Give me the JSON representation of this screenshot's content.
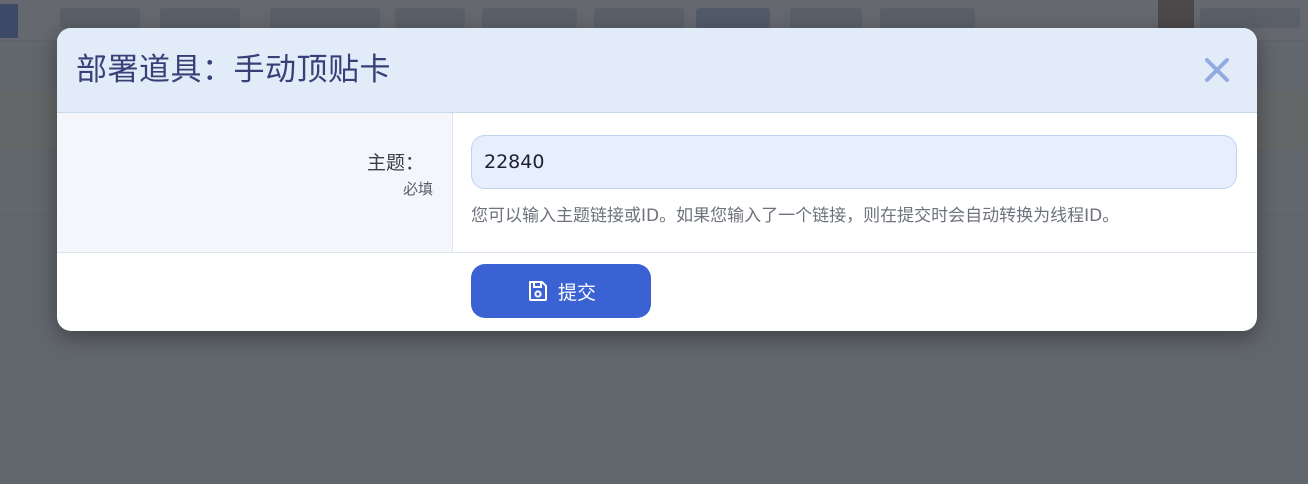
{
  "modal": {
    "title": "部署道具：手动顶贴卡",
    "close_icon": "close-icon"
  },
  "form": {
    "topic_label": "主题：",
    "required_label": "必填",
    "topic_value": "22840",
    "help_text": "您可以输入主题链接或ID。如果您输入了一个链接，则在提交时会自动转换为线程ID。"
  },
  "actions": {
    "submit_label": "提交",
    "submit_icon": "save-icon"
  },
  "colors": {
    "header_bg": "#e1ecf8",
    "title_color": "#3a3f78",
    "close_icon_color": "#93a9e2",
    "input_bg": "#e7effc",
    "submit_bg": "#3b62d3"
  }
}
